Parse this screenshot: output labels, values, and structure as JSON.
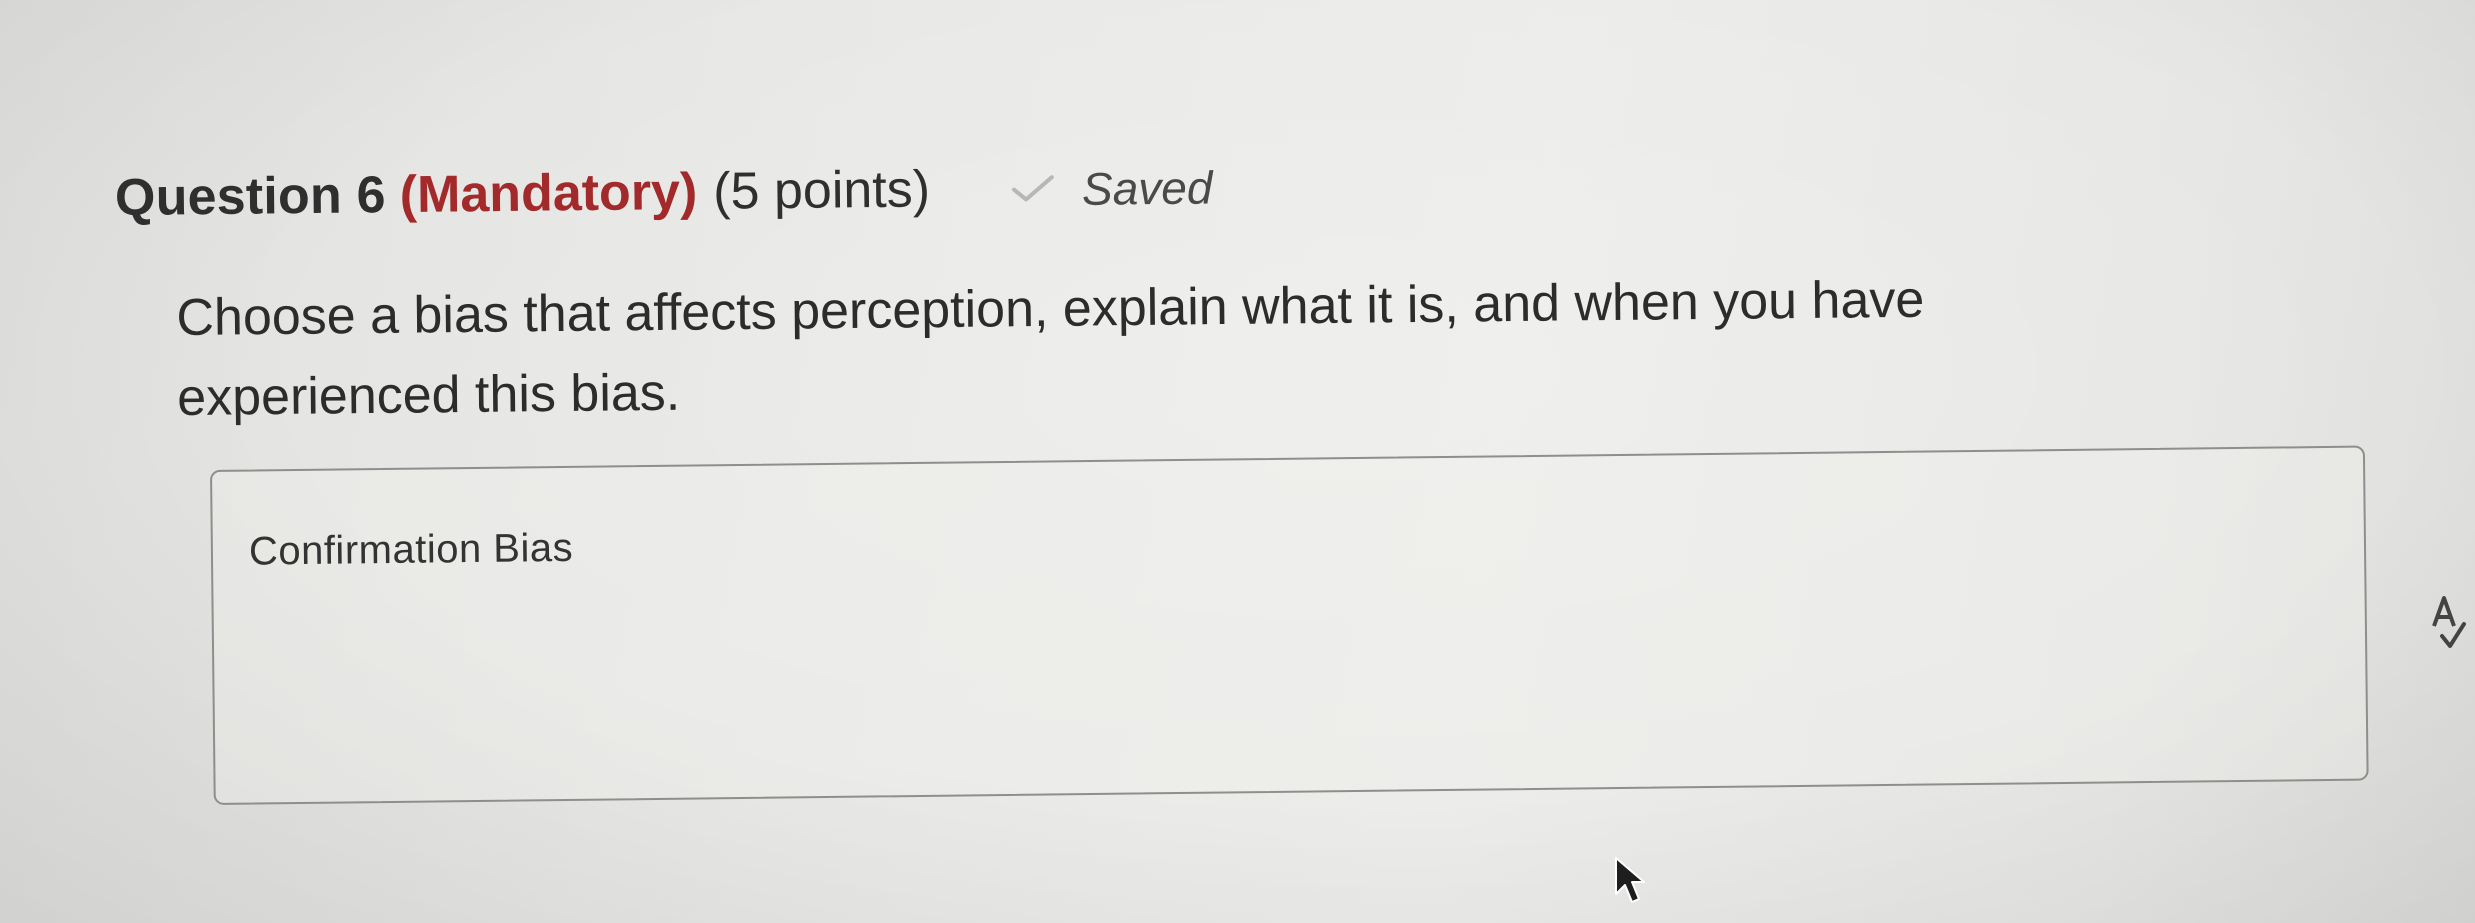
{
  "question": {
    "title": "Question 6",
    "mandatory": "(Mandatory)",
    "points": "(5 points)",
    "saved_icon": "checkmark-icon",
    "saved_label": "Saved"
  },
  "prompt": {
    "line1": "Choose a bias that affects perception, explain what it is, and when you have",
    "line2": "experienced this bias."
  },
  "answer": {
    "value": "Confirmation Bias"
  },
  "icons": {
    "accessibility": "accessibility-checker-icon",
    "cursor": "mouse-pointer-icon"
  },
  "colors": {
    "mandatory": "#a32a2a",
    "text": "#2f2f2f",
    "border": "#8e8e8e"
  }
}
